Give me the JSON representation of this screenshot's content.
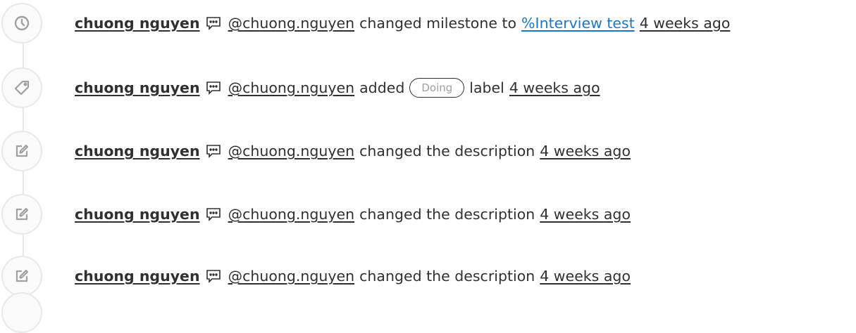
{
  "entries": [
    {
      "icon": "clock-icon",
      "author": "chuong nguyen",
      "handle": "@chuong.nguyen",
      "action": "changed milestone to",
      "link": "%Interview test",
      "time": "4 weeks ago"
    },
    {
      "icon": "label-icon",
      "author": "chuong nguyen",
      "handle": "@chuong.nguyen",
      "action": "added",
      "label": "Doing",
      "action_suffix": "label",
      "time": "4 weeks ago"
    },
    {
      "icon": "pencil-square-icon",
      "author": "chuong nguyen",
      "handle": "@chuong.nguyen",
      "action": "changed the description",
      "time": "4 weeks ago"
    },
    {
      "icon": "pencil-square-icon",
      "author": "chuong nguyen",
      "handle": "@chuong.nguyen",
      "action": "changed the description",
      "time": "4 weeks ago"
    },
    {
      "icon": "pencil-square-icon",
      "author": "chuong nguyen",
      "handle": "@chuong.nguyen",
      "action": "changed the description",
      "time": "4 weeks ago"
    }
  ],
  "colors": {
    "text": "#303030",
    "link": "#1f75cb",
    "icon": "#a0a0a0",
    "badge_bg": "#fafafa",
    "badge_border": "#e9e9e9"
  }
}
